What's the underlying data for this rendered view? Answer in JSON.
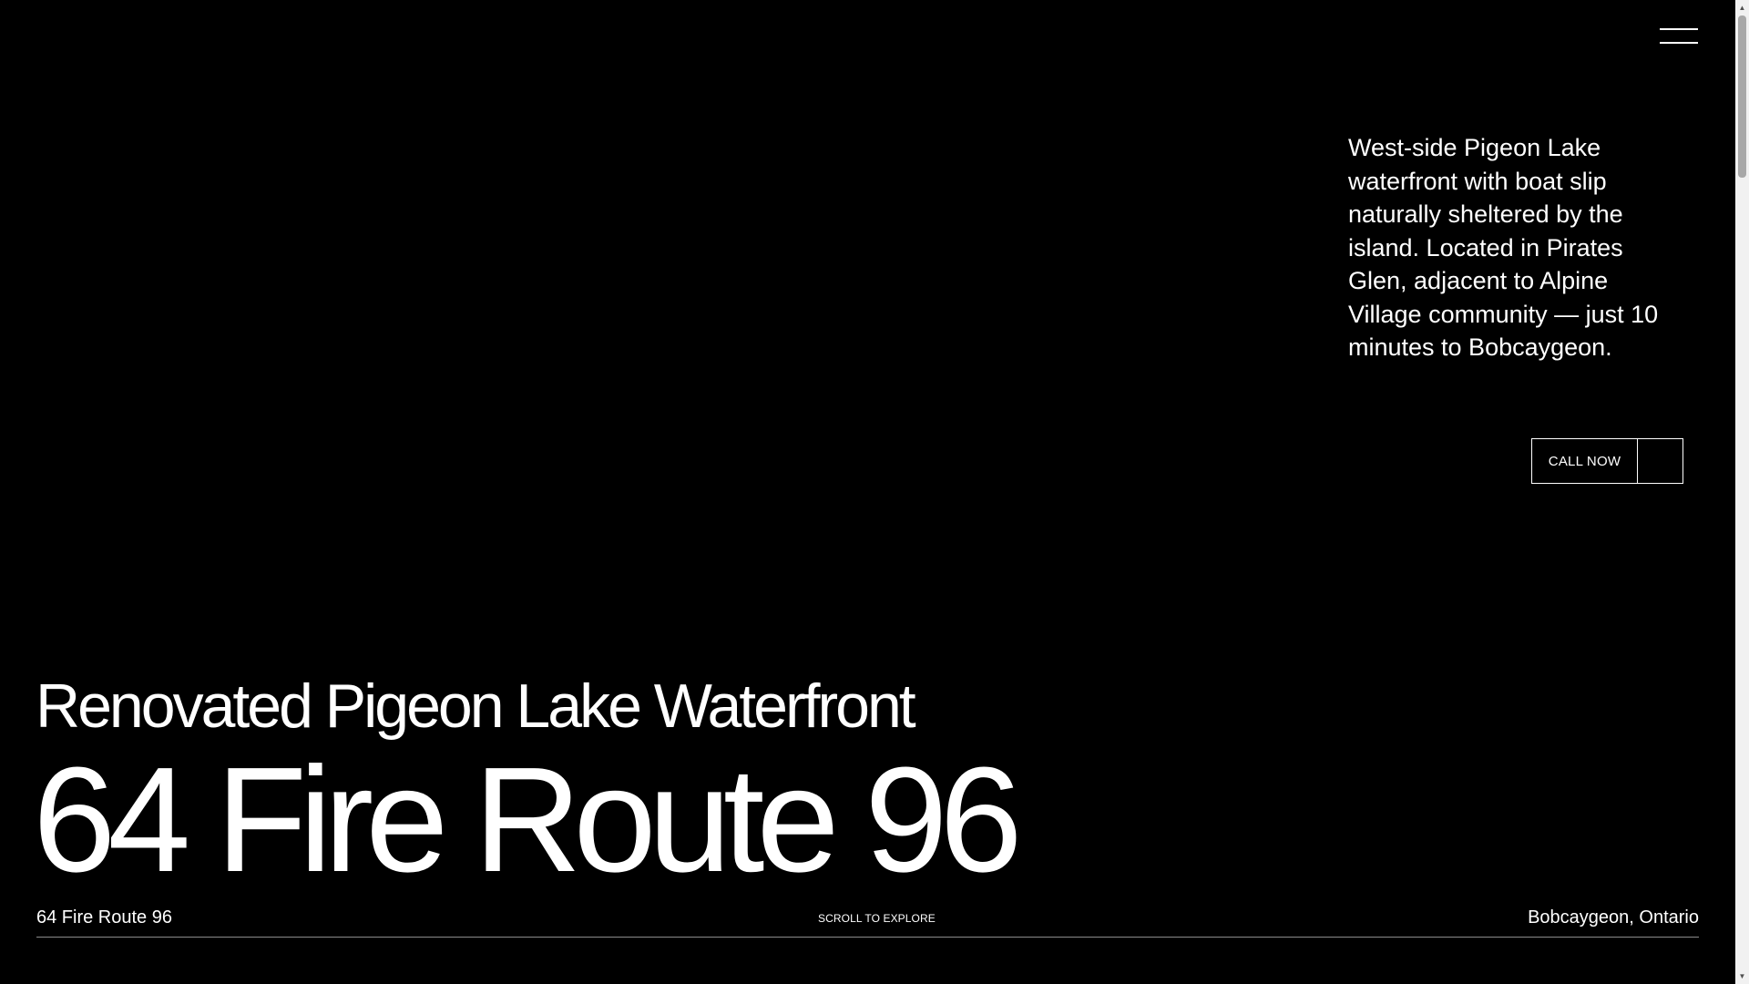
{
  "header": {
    "menu_icon": "hamburger-icon"
  },
  "hero": {
    "description": "West-side Pigeon Lake waterfront with boat slip naturally sheltered by the island. Located in Pirates Glen, adjacent to Alpine Village community — just 10 minutes to Bobcaygeon.",
    "call_button_label": "CALL NOW",
    "subtitle": "Renovated Pigeon Lake Waterfront",
    "title": "64 Fire Route 96"
  },
  "footer": {
    "address": "64 Fire Route 96",
    "scroll_prompt": "SCROLL TO EXPLORE",
    "location": "Bobcaygeon, Ontario"
  },
  "colors": {
    "background": "#000000",
    "text": "#ffffff",
    "divider": "#8a8a8a",
    "scrollbar_track": "#f1f1f1",
    "scrollbar_thumb": "#a8a8a8"
  }
}
